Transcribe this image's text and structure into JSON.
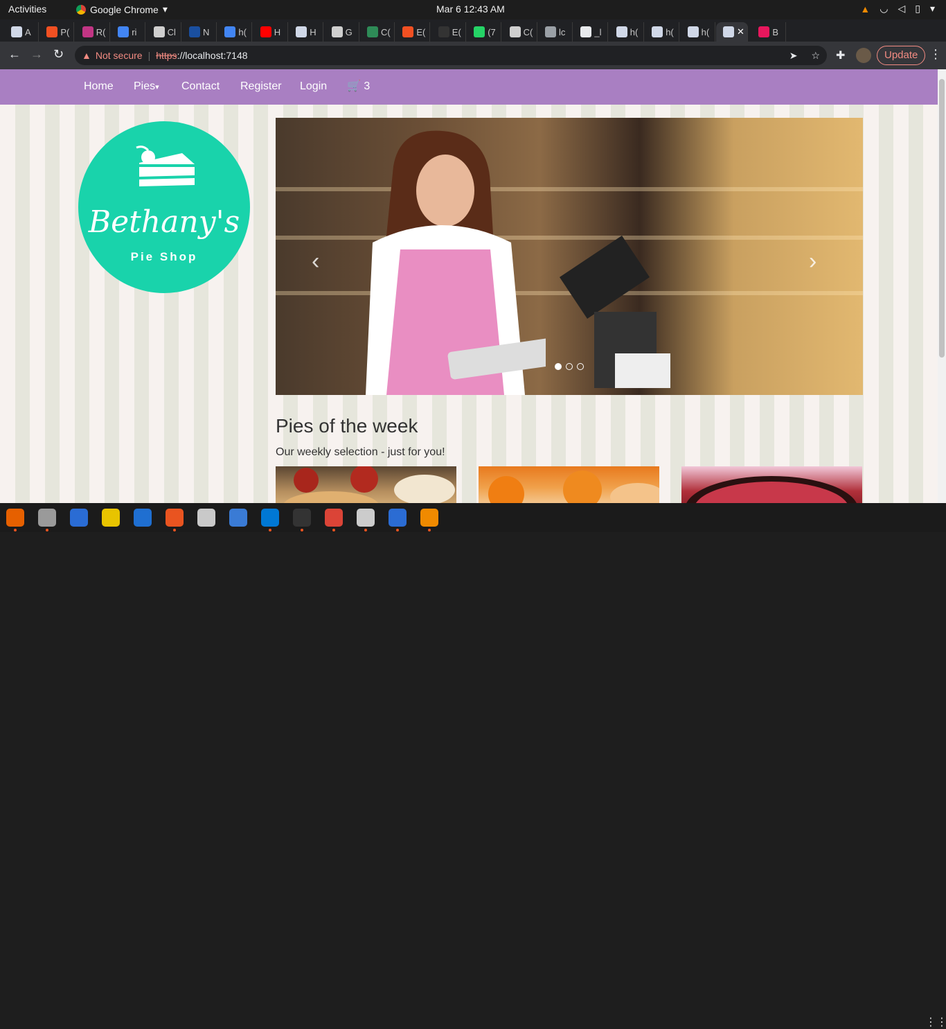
{
  "topbar": {
    "activities": "Activities",
    "app": "Google Chrome",
    "clock": "Mar 6  12:43 AM"
  },
  "tabs": [
    {
      "label": "A",
      "color": "#d0d8e8"
    },
    {
      "label": "P(",
      "color": "#f25022"
    },
    {
      "label": "R(",
      "color": "#c13584"
    },
    {
      "label": "ri",
      "color": "#4285f4"
    },
    {
      "label": "Cl",
      "color": "#cfcfcf"
    },
    {
      "label": "N",
      "color": "#1a4fa0"
    },
    {
      "label": "h(",
      "color": "#4285f4"
    },
    {
      "label": "H",
      "color": "#ff0000"
    },
    {
      "label": "H",
      "color": "#d0d8e8"
    },
    {
      "label": "G",
      "color": "#cfcfcf"
    },
    {
      "label": "C(",
      "color": "#2e8b57"
    },
    {
      "label": "E(",
      "color": "#f25022"
    },
    {
      "label": "E(",
      "color": "#333333"
    },
    {
      "label": "(7",
      "color": "#25d366"
    },
    {
      "label": "C(",
      "color": "#cfcfcf"
    },
    {
      "label": "lc",
      "color": "#9aa0a6"
    },
    {
      "label": "_l",
      "color": "#e8eaed"
    },
    {
      "label": "h(",
      "color": "#d0d8e8"
    },
    {
      "label": "h(",
      "color": "#d0d8e8"
    },
    {
      "label": "h(",
      "color": "#d0d8e8"
    },
    {
      "label": "✕",
      "color": "#d0d8e8"
    },
    {
      "label": "B",
      "color": "#e8175d"
    }
  ],
  "omnibox": {
    "security": "Not secure",
    "scheme": "https",
    "rest": "://localhost:7148"
  },
  "update_label": "Update",
  "nav": {
    "home": "Home",
    "pies": "Pies",
    "contact": "Contact",
    "register": "Register",
    "login": "Login",
    "cart_count": "3"
  },
  "logo": {
    "name": "Bethany's",
    "sub": "Pie Shop"
  },
  "section": {
    "title": "Pies of the week",
    "lead": "Our weekly selection - just for you!"
  },
  "colors": {
    "nav": "#a97fc2",
    "logo": "#19d3ab"
  }
}
